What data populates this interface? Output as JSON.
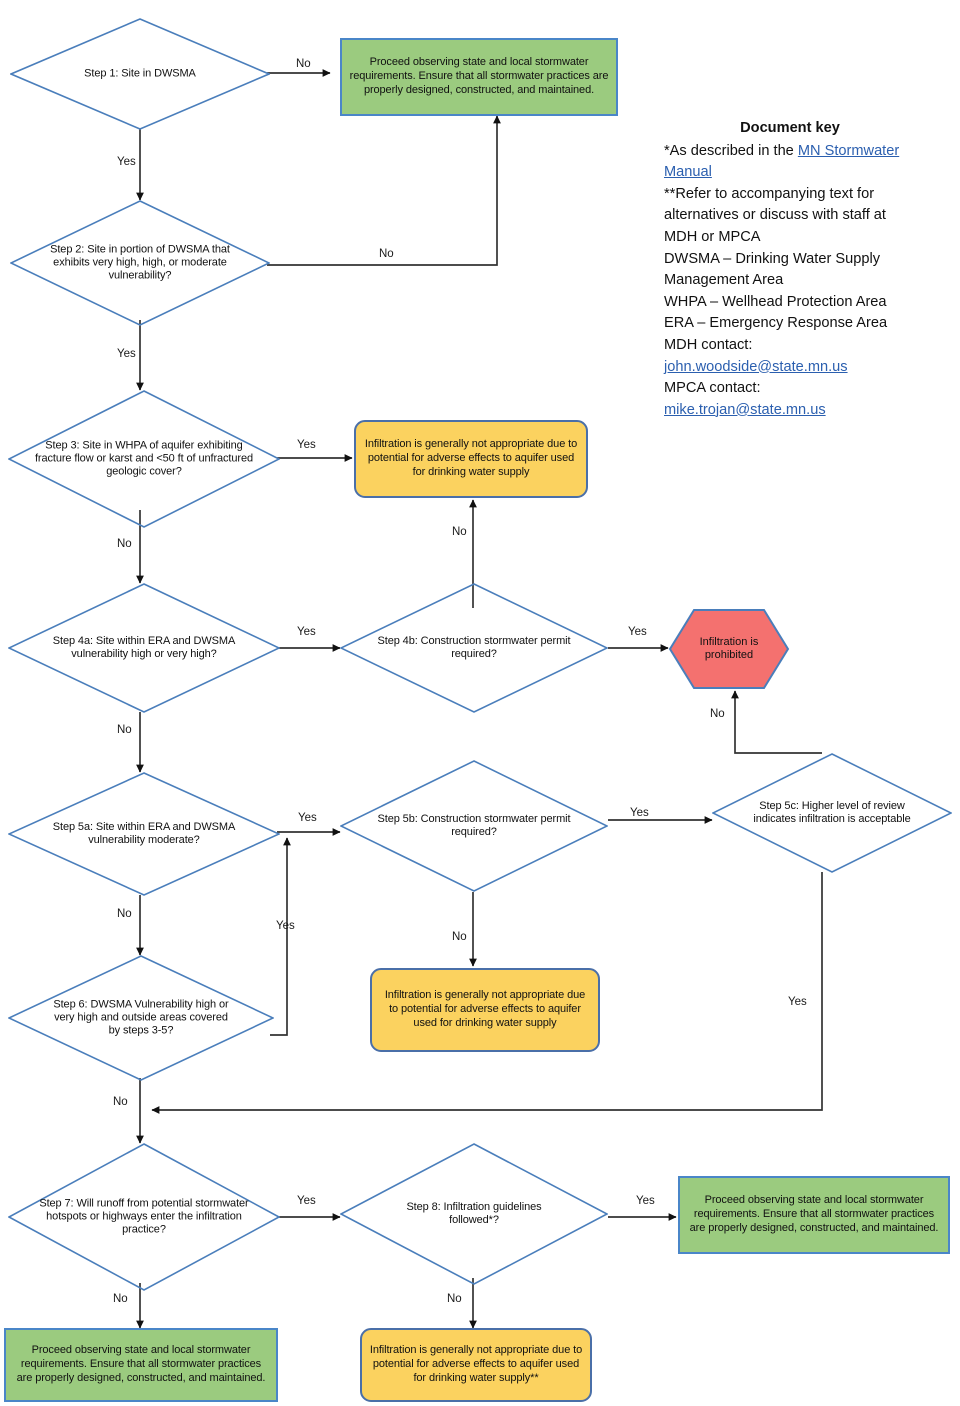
{
  "document_key": {
    "title": "Document key",
    "note_star": "*As described in the ",
    "link_manual": "MN Stormwater Manual",
    "note_doublestar": "**Refer to accompanying text for alternatives or discuss with staff at MDH or MPCA",
    "abbr_dwsma": "DWSMA – Drinking Water Supply Management Area",
    "abbr_whpa": "WHPA – Wellhead Protection Area",
    "abbr_era": "ERA – Emergency Response Area",
    "mdh_contact_label": "MDH contact:",
    "mdh_contact_email": "john.woodside@state.mn.us",
    "mpca_contact_label": "MPCA contact:",
    "mpca_contact_email": "mike.trojan@state.mn.us"
  },
  "colors": {
    "diamond_stroke": "#4A7EBB",
    "box_green_fill": "#9BCB7F",
    "box_green_border": "#4A86C8",
    "box_yellow_fill": "#FBD25F",
    "box_yellow_border": "#4A6FA8",
    "hex_fill": "#F4716F",
    "hex_border": "#4A7EBB",
    "connector": "#1a1a1a",
    "link": "#2B5FAF"
  },
  "nodes": {
    "step1": "Step 1: Site in DWSMA",
    "step2": "Step 2: Site in portion of DWSMA that exhibits very high, high, or moderate vulnerability?",
    "step3": "Step 3: Site in WHPA of aquifer exhibiting fracture flow or karst and <50 ft of unfractured geologic cover?",
    "step4a": "Step 4a: Site within ERA and DWSMA vulnerability high or very high?",
    "step4b": "Step 4b: Construction stormwater permit required?",
    "step5a": "Step 5a: Site within ERA and DWSMA vulnerability moderate?",
    "step5b": "Step 5b: Construction stormwater permit required?",
    "step5c": "Step 5c: Higher level of review indicates infiltration is acceptable",
    "step6": "Step 6: DWSMA Vulnerability high or very high and outside areas covered by steps 3-5?",
    "step7": "Step 7: Will runoff from potential stormwater hotspots or highways enter the infiltration practice?",
    "step8": "Step 8: Infiltration guidelines followed*?",
    "proceed_top": "Proceed observing state and local stormwater requirements. Ensure that all stormwater practices are properly designed, constructed, and maintained.",
    "proceed_right": "Proceed observing state and local stormwater requirements. Ensure that all stormwater practices are properly designed, constructed, and maintained.",
    "proceed_bottom": "Proceed observing state and local stormwater requirements. Ensure that all stormwater practices are properly designed, constructed, and maintained.",
    "not_appropriate_top": "Infiltration is generally not appropriate due to potential for adverse effects to aquifer used for drinking water supply",
    "not_appropriate_mid": "Infiltration is generally not appropriate due to potential for adverse effects to aquifer used for drinking water supply",
    "not_appropriate_bottom": "Infiltration is generally not appropriate due to potential for adverse effects to aquifer used for drinking water supply**",
    "prohibited": "Infiltration is prohibited"
  },
  "edge_labels": {
    "step1_no": "No",
    "step1_yes": "Yes",
    "step2_no": "No",
    "step2_yes": "Yes",
    "step3_yes": "Yes",
    "step3_no": "No",
    "step4b_no": "No",
    "step4a_yes": "Yes",
    "step4a_no": "No",
    "step4b_yes": "Yes",
    "step5c_no": "No",
    "step5a_yes": "Yes",
    "step5a_no": "No",
    "step5b_yes": "Yes",
    "step5b_no": "No",
    "step6_yes": "Yes",
    "step6_no": "No",
    "step5c_yes": "Yes",
    "step7_yes": "Yes",
    "step7_no": "No",
    "step8_yes": "Yes",
    "step8_no": "No"
  }
}
